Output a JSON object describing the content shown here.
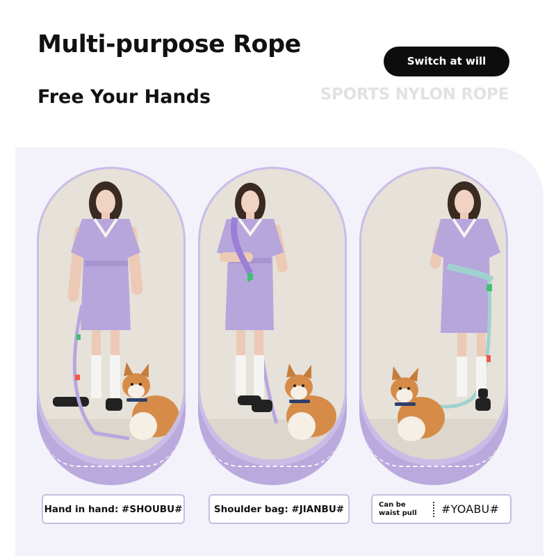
{
  "header": {
    "title": "Multi-purpose Rope",
    "subtitle": "Free Your Hands",
    "pill_label": "Switch at will",
    "watermark": "SPORTS NYLON ROPE"
  },
  "cards": [
    {
      "label": "Hand in hand: #SHOUBU#"
    },
    {
      "label": "Shoulder bag: #JIANBU#"
    },
    {
      "label_small": "Can be waist pull",
      "label_tag": "#YOABU#"
    }
  ],
  "colors": {
    "pill_bg": "#0d0d0d",
    "panel_bg": "#f3f1fa",
    "card_frame": "#c9bde7",
    "card_base": "#b9a9dc",
    "label_border": "#c5bee0",
    "dress": "#b7a6dc"
  }
}
